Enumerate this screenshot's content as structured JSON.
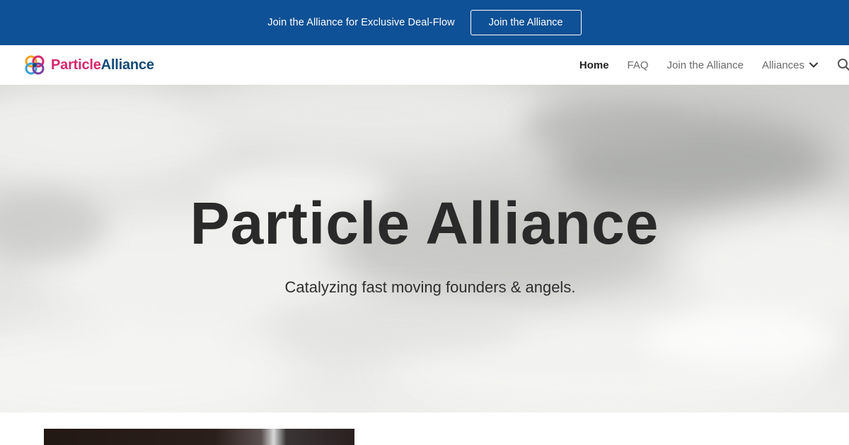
{
  "banner": {
    "text": "Join the Alliance for Exclusive Deal-Flow",
    "button_label": "Join the Alliance"
  },
  "header": {
    "logo": {
      "text_part1": "Particle",
      "text_part2": "Alliance",
      "icon": "particle-alliance-logo-icon"
    },
    "nav": {
      "items": [
        {
          "label": "Home",
          "active": true
        },
        {
          "label": "FAQ",
          "active": false
        },
        {
          "label": "Join the Alliance",
          "active": false
        },
        {
          "label": "Alliances",
          "active": false,
          "has_dropdown": true
        }
      ],
      "search_icon": "search-icon"
    }
  },
  "hero": {
    "title": "Particle Alliance",
    "subtitle": "Catalyzing fast moving founders & angels.",
    "background": "cloudy-sky-photo"
  },
  "colors": {
    "banner_bg": "#0f5196",
    "logo_pink": "#d6286e",
    "logo_navy": "#134b7a",
    "nav_active": "#222222",
    "nav_inactive": "#6b6b6b"
  }
}
